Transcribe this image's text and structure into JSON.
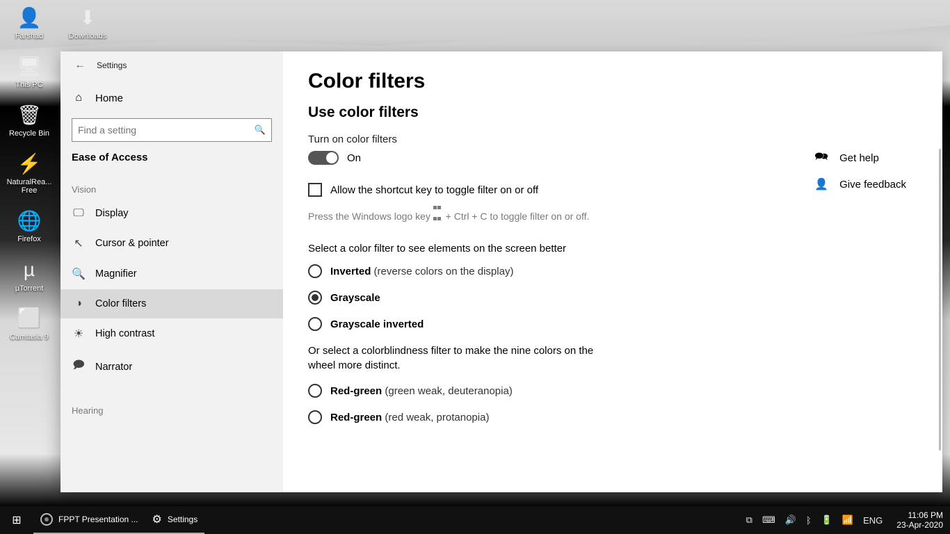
{
  "desktop_icons": {
    "r0c0": "Farshad",
    "r0c1": "Downloads",
    "r1": "This PC",
    "r2": "Recycle Bin",
    "r3": "NaturalRea... Free",
    "r4": "Firefox",
    "r5": "µTorrent",
    "r6": "Camtasia 9"
  },
  "window": {
    "app_title": "Settings",
    "home": "Home",
    "search_placeholder": "Find a setting",
    "section": "Ease of Access",
    "groups": {
      "vision": "Vision",
      "hearing": "Hearing"
    },
    "nav": {
      "display": "Display",
      "cursor": "Cursor & pointer",
      "magnifier": "Magnifier",
      "color_filters": "Color filters",
      "high_contrast": "High contrast",
      "narrator": "Narrator"
    }
  },
  "content": {
    "title": "Color filters",
    "use_heading": "Use color filters",
    "turn_on_label": "Turn on color filters",
    "toggle_state": "On",
    "shortcut_check": "Allow the shortcut key to toggle filter on or off",
    "shortcut_hint_a": "Press the Windows logo key ",
    "shortcut_hint_b": " + Ctrl + C to toggle filter on or off.",
    "select_txt": "Select a color filter to see elements on the screen better",
    "radios": {
      "inverted": "Inverted",
      "inverted_p": "(reverse colors on the display)",
      "grayscale": "Grayscale",
      "grayscale_inv": "Grayscale inverted",
      "rg1": "Red-green",
      "rg1_p": "(green weak, deuteranopia)",
      "rg2": "Red-green",
      "rg2_p": "(red weak, protanopia)"
    },
    "cb_txt": "Or select a colorblindness filter to make the nine colors on the wheel more distinct.",
    "help": "Get help",
    "feedback": "Give feedback"
  },
  "taskbar": {
    "app1": "FPPT Presentation ...",
    "app2": "Settings",
    "lang": "ENG",
    "time": "11:06 PM",
    "date": "23-Apr-2020"
  }
}
